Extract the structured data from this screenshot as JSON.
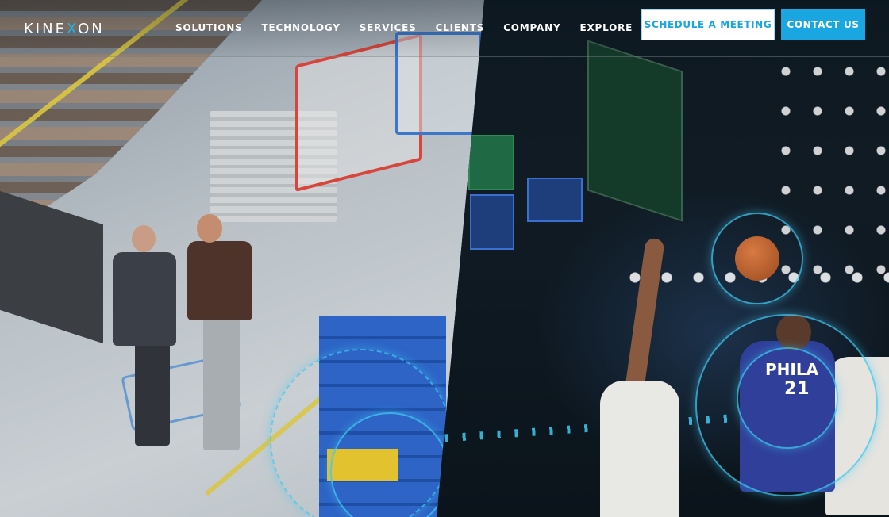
{
  "brand": {
    "logo_prefix": "KINE",
    "logo_accent": "X",
    "logo_suffix": "ON",
    "accent_color": "#1aa6e0"
  },
  "nav": {
    "items": [
      {
        "label": "SOLUTIONS"
      },
      {
        "label": "TECHNOLOGY"
      },
      {
        "label": "SERVICES"
      },
      {
        "label": "CLIENTS"
      },
      {
        "label": "COMPANY"
      },
      {
        "label": "EXPLORE"
      }
    ]
  },
  "actions": {
    "schedule_label": "SCHEDULE A MEETING",
    "contact_label": "CONTACT US"
  },
  "hero": {
    "left_scene": "warehouse",
    "right_scene": "basketball-arena",
    "jersey_text": "PHILA",
    "jersey_number": "21",
    "ring_color": "#40c8f0"
  }
}
